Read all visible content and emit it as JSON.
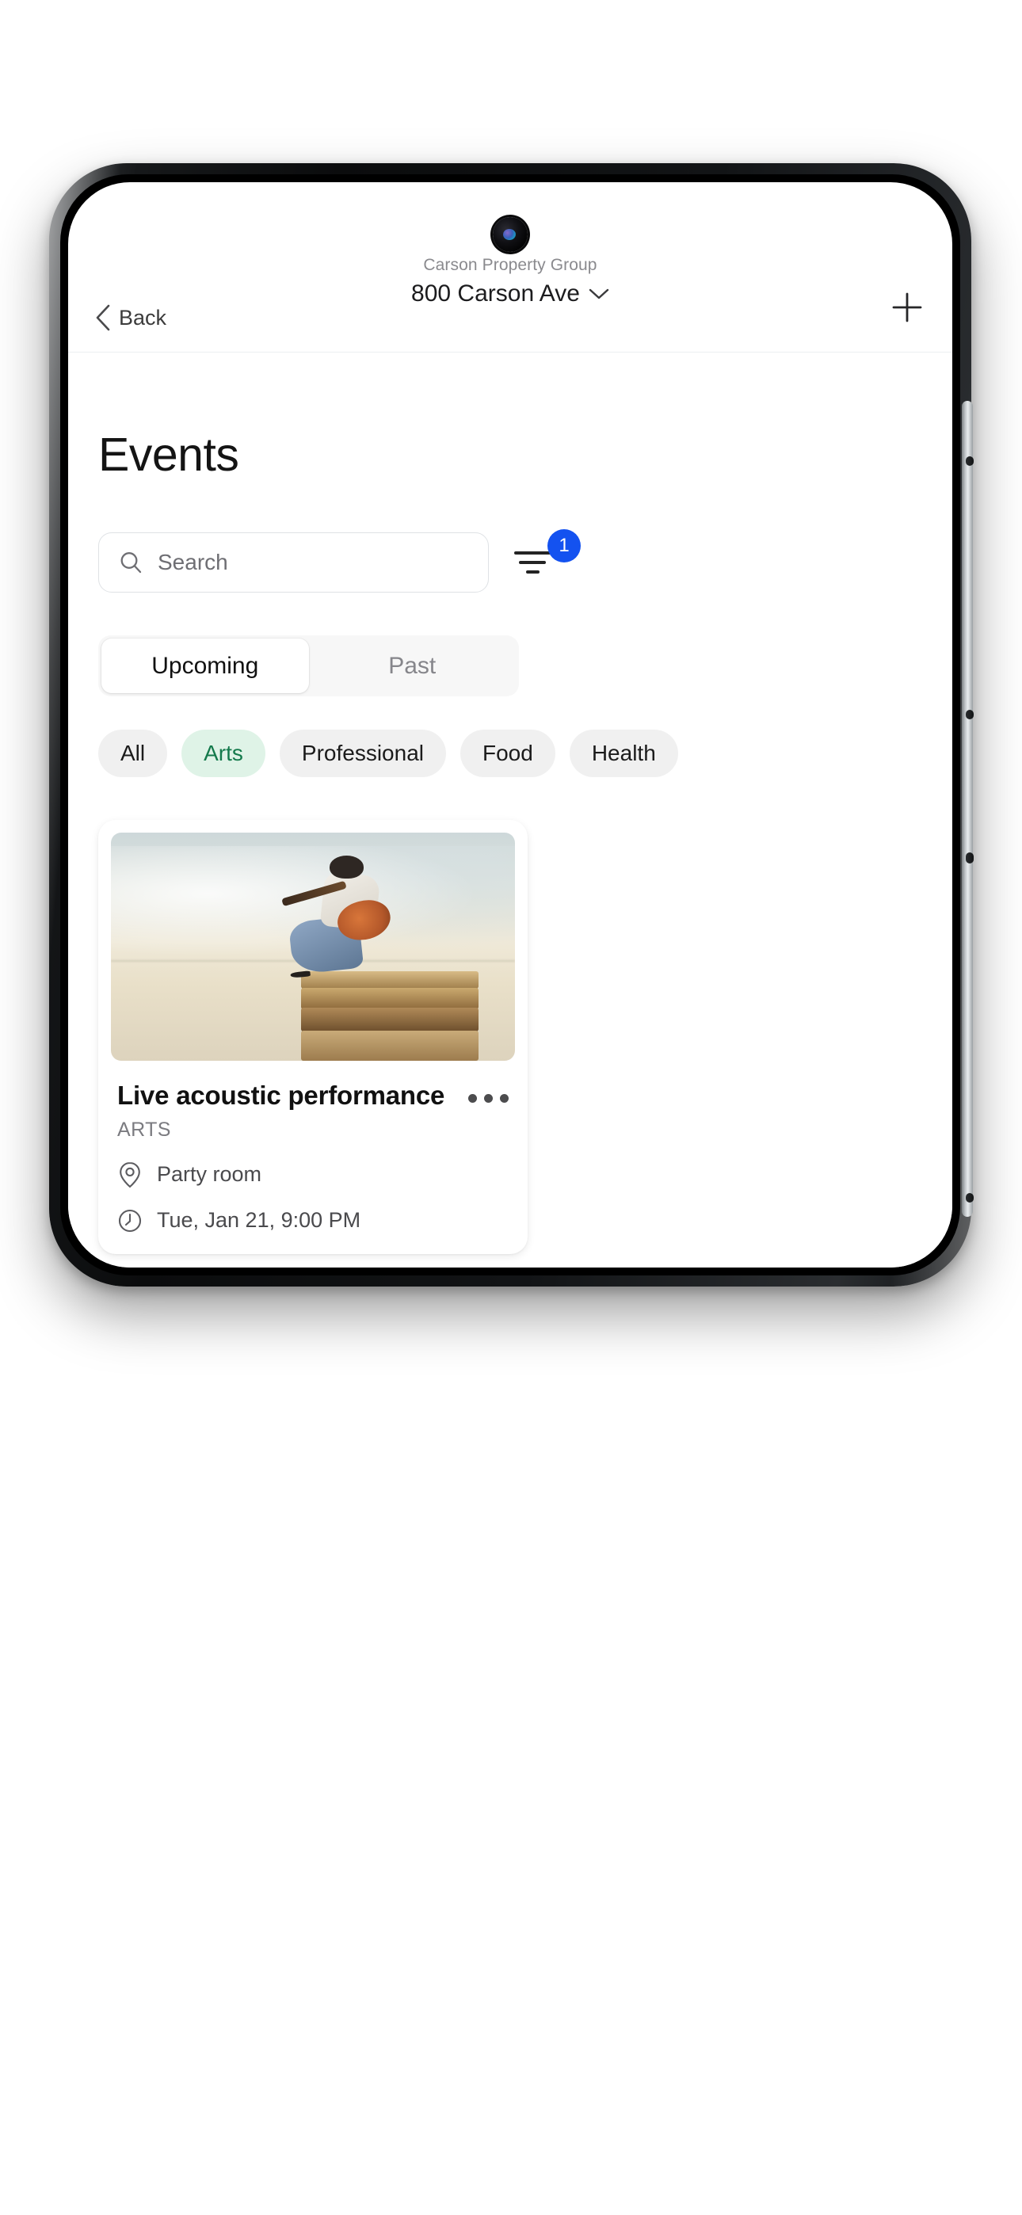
{
  "nav": {
    "back_label": "Back",
    "subtitle": "Carson Property Group",
    "title": "800 Carson Ave",
    "dropdown_icon": "chevron-down-icon",
    "back_icon": "chevron-left-icon",
    "add_icon": "plus-icon"
  },
  "page": {
    "heading": "Events"
  },
  "search": {
    "placeholder": "Search",
    "value": "",
    "icon": "search-icon"
  },
  "filter": {
    "icon": "filter-icon",
    "badge_count": "1",
    "badge_color": "#1452f0"
  },
  "tabs": [
    {
      "label": "Upcoming",
      "active": true
    },
    {
      "label": "Past",
      "active": false
    }
  ],
  "categories": [
    {
      "label": "All",
      "selected": false
    },
    {
      "label": "Arts",
      "selected": true
    },
    {
      "label": "Professional",
      "selected": false
    },
    {
      "label": "Food",
      "selected": false
    },
    {
      "label": "Health",
      "selected": false
    }
  ],
  "category_selected_colors": {
    "text": "#147a4c",
    "background": "#dff3e7"
  },
  "events": [
    {
      "title": "Live acoustic performance",
      "category": "ARTS",
      "location": "Party room",
      "location_icon": "location-pin-icon",
      "datetime": "Tue, Jan 21, 9:00 PM",
      "time_icon": "clock-icon",
      "menu_icon": "overflow-menu-icon",
      "image_alt": "guitarist-on-stack-of-books"
    },
    {
      "title": "",
      "category": "",
      "location": "",
      "datetime": "",
      "image_alt": "group-photo-with-orange-bunting"
    }
  ]
}
